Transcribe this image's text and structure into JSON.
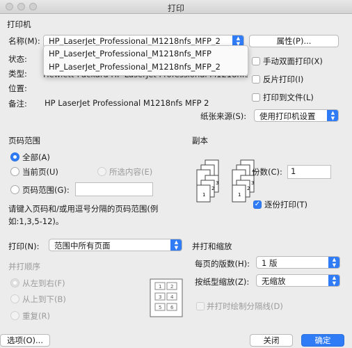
{
  "window": {
    "title": "打印"
  },
  "printer": {
    "section_label": "打印机",
    "name_label": "名称(M):",
    "name_value": "HP_LaserJet_Professional_M1218nfs_MFP_2",
    "properties_button": "属性(P)...",
    "status_label": "状态:",
    "type_label": "类型:",
    "type_value_partial": "Hewlett-Packard HP LaserJet Professional M1218nfs MFP",
    "location_label": "位置:",
    "comment_label": "备注:",
    "comment_value": "HP LaserJet Professional M1218nfs MFP 2",
    "dropdown_options": [
      "HP_LaserJet_Professional_M1218nfs_MFP",
      "HP_LaserJet_Professional_M1218nfs_MFP_2"
    ],
    "duplex_label": "手动双面打印(X)",
    "reverse_label": "反片打印(I)",
    "to_file_label": "打印到文件(L)",
    "paper_source_label": "纸张来源(S):",
    "paper_source_value": "使用打印机设置"
  },
  "page_range": {
    "section_label": "页码范围",
    "all_label": "全部(A)",
    "current_label": "当前页(U)",
    "selection_label": "所选内容(E)",
    "pages_label": "页码范围(G):",
    "pages_value": "",
    "hint_line1": "请键入页码和/或用逗号分隔的页码范围(例",
    "hint_line2": "如:1,3,5-12)。"
  },
  "copies": {
    "section_label": "副本",
    "count_label": "份数(C):",
    "count_value": "1",
    "collate_label": "逐份打印(T)",
    "collate_checked": true,
    "stack_numbers": [
      "1",
      "2",
      "3"
    ]
  },
  "print_what": {
    "label": "打印(N):",
    "value": "范围中所有页面"
  },
  "order": {
    "section_label": "并打顺序",
    "ltr_label": "从左到右(F)",
    "ttb_label": "从上到下(B)",
    "repeat_label": "重复(R)",
    "preview_numbers": [
      "1",
      "2",
      "3",
      "4",
      "5",
      "6"
    ]
  },
  "zoom": {
    "section_label": "并打和缩放",
    "pages_per_sheet_label": "每页的版数(H):",
    "pages_per_sheet_value": "1 版",
    "scale_label": "按纸型缩放(Z):",
    "scale_value": "无缩放",
    "draw_borders_label": "并打时绘制分隔线(D)"
  },
  "footer": {
    "options_button": "选项(O)...",
    "close_button": "关闭",
    "ok_button": "确定"
  },
  "colors": {
    "accent": "#2f7cf6",
    "window_bg": "#ececec"
  }
}
